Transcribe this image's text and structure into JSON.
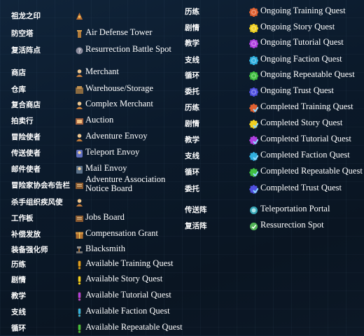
{
  "left_column": [
    {
      "cn": "祖龙之印",
      "en": "",
      "icon": "dragon-seal-icon"
    },
    {
      "cn": "防空塔",
      "en": "Air Defense Tower",
      "icon": "tower-icon"
    },
    {
      "cn": "复活阵点",
      "en": "Resurrection Battle Spot",
      "icon": "resurrection-spot-icon"
    },
    {
      "cn": "商店",
      "en": "Merchant",
      "icon": "merchant-icon"
    },
    {
      "cn": "仓库",
      "en": "Warehouse/Storage",
      "icon": "warehouse-icon"
    },
    {
      "cn": "复合商店",
      "en": "Complex Merchant",
      "icon": "complex-merchant-icon"
    },
    {
      "cn": "拍卖行",
      "en": "Auction",
      "icon": "auction-icon"
    },
    {
      "cn": "冒险使者",
      "en": "Adventure Envoy",
      "icon": "adventure-envoy-icon"
    },
    {
      "cn": "传送使者",
      "en": "Teleport Envoy",
      "icon": "teleport-envoy-icon"
    },
    {
      "cn": "邮件使者",
      "en": "Mail Envoy",
      "icon": "mail-envoy-icon"
    },
    {
      "cn": "冒险家协会布告栏",
      "en": "Adventure Association Notice Board",
      "icon": "notice-board-icon"
    },
    {
      "cn": "杀手组织疾风使",
      "en": "",
      "icon": "assassin-envoy-icon"
    },
    {
      "cn": "工作板",
      "en": "Jobs Board",
      "icon": "jobs-board-icon"
    },
    {
      "cn": "补偿发放",
      "en": "Compensation Grant",
      "icon": "compensation-icon"
    },
    {
      "cn": "装备强化师",
      "en": "Blacksmith",
      "icon": "blacksmith-icon"
    },
    {
      "cn": "历练",
      "en": "Available Training Quest",
      "icon": "exclamation-icon",
      "color": "#e0a020"
    },
    {
      "cn": "剧情",
      "en": "Available Story Quest",
      "icon": "exclamation-icon",
      "color": "#f0d020"
    },
    {
      "cn": "教学",
      "en": "Available Tutorial Quest",
      "icon": "exclamation-icon",
      "color": "#b040e0"
    },
    {
      "cn": "支线",
      "en": "Available Faction Quest",
      "icon": "exclamation-icon",
      "color": "#30b0e0"
    },
    {
      "cn": "循环",
      "en": "Available Repeatable Quest",
      "icon": "exclamation-icon",
      "color": "#40c040"
    }
  ],
  "right_column": [
    {
      "cn": "历练",
      "en": "Ongoing Training Quest",
      "icon": "gear-icon",
      "color": "#e06030"
    },
    {
      "cn": "剧情",
      "en": "Ongoing Story Quest",
      "icon": "gear-icon",
      "color": "#f0d020"
    },
    {
      "cn": "教学",
      "en": "Ongoing Tutorial Quest",
      "icon": "gear-icon",
      "color": "#b040e0"
    },
    {
      "cn": "支线",
      "en": "Ongoing Faction Quest",
      "icon": "gear-icon",
      "color": "#30b0e0"
    },
    {
      "cn": "循环",
      "en": "Ongoing Repeatable Quest",
      "icon": "gear-icon",
      "color": "#40c040"
    },
    {
      "cn": "委托",
      "en": "Ongoing Trust Quest",
      "icon": "gear-icon",
      "color": "#5050e0"
    },
    {
      "cn": "历练",
      "en": "Completed Training Quest",
      "icon": "check-gear-icon",
      "color": "#e06030"
    },
    {
      "cn": "剧情",
      "en": "Completed Story Quest",
      "icon": "check-gear-icon",
      "color": "#f0d020"
    },
    {
      "cn": "教学",
      "en": "Completed Tutorial Quest",
      "icon": "check-gear-icon",
      "color": "#b040e0"
    },
    {
      "cn": "支线",
      "en": "Completed Faction Quest",
      "icon": "check-gear-icon",
      "color": "#30b0e0"
    },
    {
      "cn": "循环",
      "en": "Completed Repeatable Quest",
      "icon": "check-gear-icon",
      "color": "#40c040"
    },
    {
      "cn": "委托",
      "en": "Completed Trust Quest",
      "icon": "check-gear-icon",
      "color": "#5050e0"
    },
    {
      "cn": "传送阵",
      "en": "Teleportation Portal",
      "icon": "portal-icon",
      "color": "#40c0d0"
    },
    {
      "cn": "复活阵",
      "en": "Ressurection Spot",
      "icon": "revive-icon",
      "color": "#60d060"
    }
  ]
}
